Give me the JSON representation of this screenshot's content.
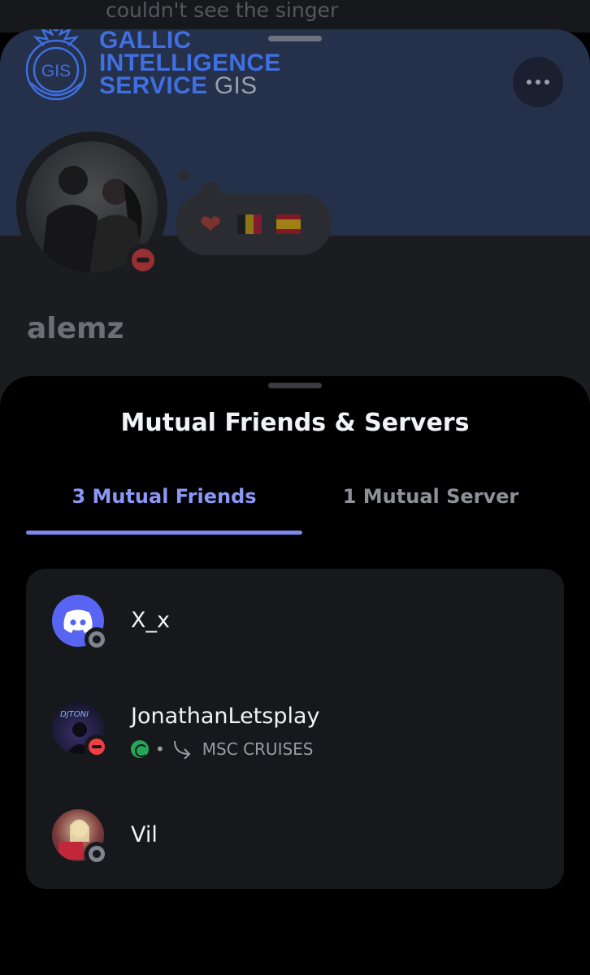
{
  "background": {
    "caption": "couldn't see the singer",
    "logo": {
      "emblem_text": "GIS",
      "line1": "GALLIC",
      "line2": "INTELLIGENCE",
      "line3": "SERVICE",
      "line3_suffix": "GIS"
    },
    "username": "alemz",
    "status_icons": [
      "red-heart",
      "belgium-flag",
      "spain-flag"
    ]
  },
  "sheet": {
    "title": "Mutual Friends & Servers",
    "tabs": [
      {
        "label": "3 Mutual Friends",
        "active": true
      },
      {
        "label": "1 Mutual Server",
        "active": false
      }
    ],
    "friends": [
      {
        "name": "X_x",
        "status": "offline",
        "avatar": "discord-logo"
      },
      {
        "name": "JonathanLetsplay",
        "status": "dnd",
        "avatar_text": "DJTONI",
        "activity": {
          "separator": "•",
          "label": "MSC CRUISES"
        }
      },
      {
        "name": "Vil",
        "status": "offline",
        "avatar": "photo"
      }
    ]
  },
  "colors": {
    "accent": "#8b97f5",
    "tab_indicator": "#7c86ee",
    "dnd": "#f23f43",
    "offline": "#80848e",
    "blurple": "#5865f2"
  }
}
